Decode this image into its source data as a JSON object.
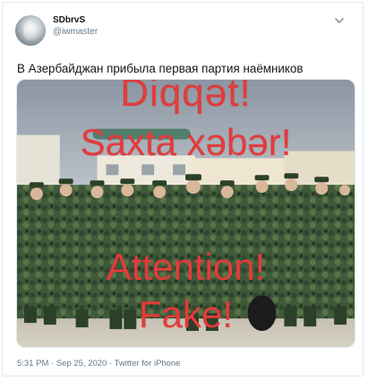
{
  "author": {
    "display_name": "SDbrvS",
    "handle": "@iwmaster"
  },
  "tweet": {
    "text": "В Азербайджан прибыла первая партия наёмников",
    "timestamp": "5:31 PM · Sep 25, 2020 · Twitter for iPhone"
  },
  "media_overlay": {
    "line1": "Diqqət!",
    "line2": "Saxta xəbər!",
    "line3": "Attention!",
    "line4": "Fake!",
    "color": "#e43b3b"
  },
  "icons": {
    "menu": "chevron-down-icon",
    "avatar": "avatar"
  },
  "colors": {
    "text": "#14171a",
    "secondary": "#657786",
    "border": "#e1e8ed"
  }
}
